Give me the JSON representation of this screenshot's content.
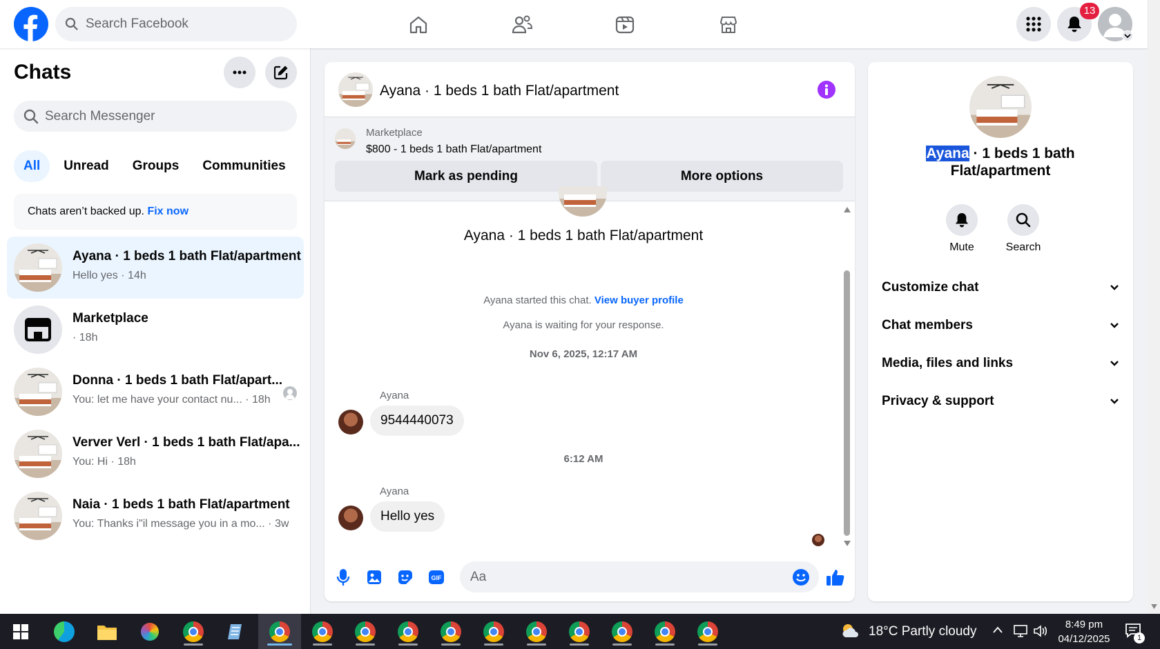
{
  "header": {
    "search_placeholder": "Search Facebook",
    "notification_count": "13"
  },
  "sidebar": {
    "title": "Chats",
    "search_placeholder": "Search Messenger",
    "filters": [
      "All",
      "Unread",
      "Groups",
      "Communities"
    ],
    "backup_text": "Chats aren’t backed up.",
    "backup_link": "Fix now",
    "chats": [
      {
        "name": "Ayana · 1 beds 1 bath Flat/apartment",
        "preview": "Hello yes",
        "time": "· 14h"
      },
      {
        "name": "Marketplace",
        "preview": "",
        "time": "· 18h"
      },
      {
        "name": "Donna · 1 beds 1 bath Flat/apart...",
        "preview": "You: let me have your contact nu...",
        "time": "· 18h"
      },
      {
        "name": "Verver Verl · 1 beds 1 bath Flat/apa...",
        "preview": "You: Hi",
        "time": "· 18h"
      },
      {
        "name": "Naia · 1 beds 1 bath Flat/apartment",
        "preview": "You: Thanks i\"il message you in a mo...",
        "time": "· 3w"
      }
    ]
  },
  "conversation": {
    "title": "Ayana · 1 beds 1 bath Flat/apartment",
    "marketplace_label": "Marketplace",
    "listing": "$800 - 1 beds 1 bath Flat/apartment",
    "mark_pending": "Mark as pending",
    "more_options": "More options",
    "intro_name": "Ayana · 1 beds 1 bath Flat/apartment",
    "started_text": "Ayana started this chat.",
    "buyer_link": "View buyer profile",
    "waiting_text": "Ayana is waiting for your response.",
    "timestamp1": "Nov 6, 2025, 12:17 AM",
    "sender1": "Ayana",
    "message1": "9544440073",
    "timestamp2": "6:12 AM",
    "sender2": "Ayana",
    "message2": "Hello yes",
    "composer_placeholder": "Aa"
  },
  "details": {
    "name_highlight": "Ayana",
    "name_line1_rest": " · 1 beds 1 bath",
    "name_line2": "Flat/apartment",
    "mute": "Mute",
    "search": "Search",
    "sections": [
      "Customize chat",
      "Chat members",
      "Media, files and links",
      "Privacy & support"
    ]
  },
  "taskbar": {
    "weather": "18°C  Partly cloudy",
    "time": "8:49 pm",
    "date": "04/12/2025",
    "notif_count": "1"
  },
  "colors": {
    "brand": "#0866ff",
    "badge": "#e41e3f",
    "info": "#a033ff"
  }
}
